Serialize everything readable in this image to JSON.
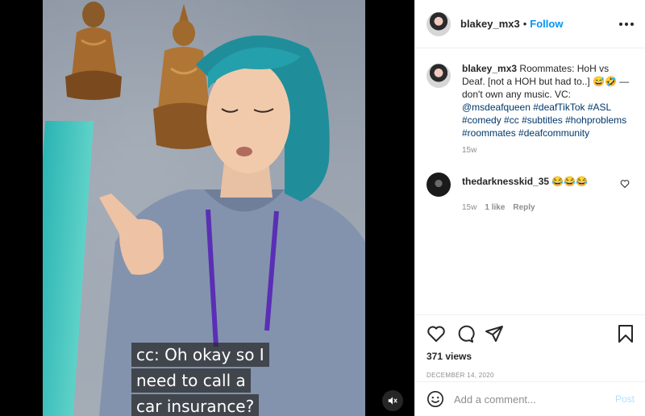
{
  "header": {
    "username": "blakey_mx3",
    "separator": "•",
    "follow_label": "Follow"
  },
  "post": {
    "caption_user": "blakey_mx3",
    "caption_text": "Roommates: HoH vs Deaf. [not a HOH but had to..] 😅🤣 — don't own any music. VC:",
    "caption_links": [
      "@msdeafqueen",
      "#deafTikTok",
      "#ASL",
      "#comedy",
      "#cc",
      "#subtitles",
      "#hohproblems",
      "#roommates",
      "#deafcommunity"
    ],
    "time": "15w"
  },
  "comments": [
    {
      "user": "thedarknesskid_35",
      "text": "😂😂😂",
      "time": "15w",
      "likes": "1 like",
      "reply_label": "Reply"
    }
  ],
  "video": {
    "captions": [
      "cc: Oh okay so I",
      "need to call a",
      "car insurance?"
    ],
    "icon": "mute-icon"
  },
  "stats": {
    "views": "371 views",
    "date": "DECEMBER 14, 2020"
  },
  "add_comment": {
    "placeholder": "Add a comment...",
    "post_label": "Post"
  },
  "icons": {
    "like": "heart-icon",
    "comment": "comment-icon",
    "share": "share-icon",
    "save": "bookmark-icon",
    "emoji": "emoji-icon",
    "more": "more-icon"
  },
  "colors": {
    "accent": "#0095f6",
    "link": "#00376b",
    "muted": "#8e8e8e"
  }
}
